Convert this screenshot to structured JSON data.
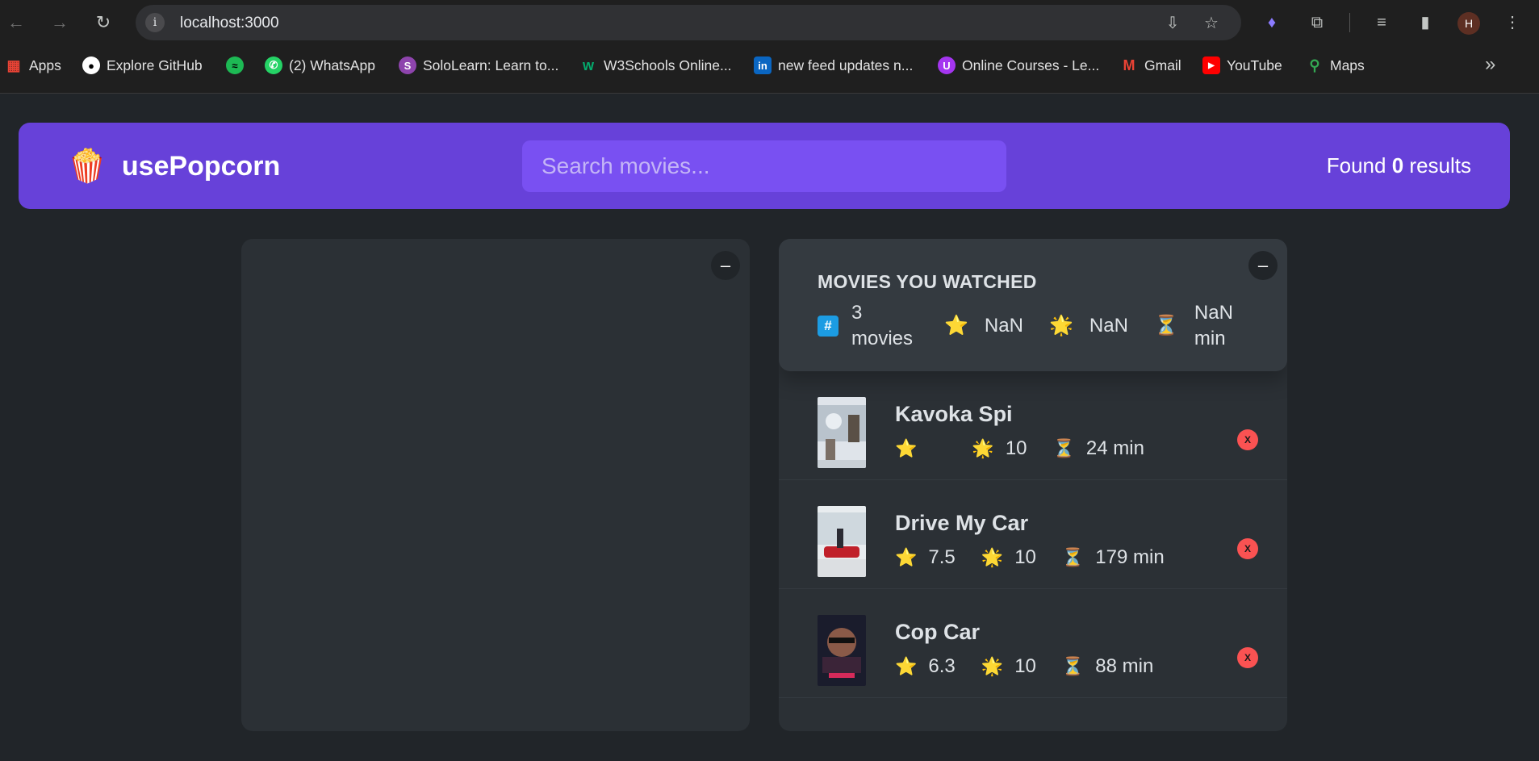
{
  "browser": {
    "url": "localhost:3000",
    "profile_initial": "H",
    "bookmarks": [
      {
        "label": "Apps",
        "icon": "apps-grid-icon",
        "color": "#ea4335"
      },
      {
        "label": "Explore GitHub",
        "icon": "github-icon",
        "color": "#ffffff"
      },
      {
        "label": "",
        "icon": "spotify-icon",
        "color": "#1db954"
      },
      {
        "label": "(2) WhatsApp",
        "icon": "whatsapp-icon",
        "color": "#25d366"
      },
      {
        "label": "SoloLearn: Learn to...",
        "icon": "sololearn-icon",
        "color": "#8e44ad"
      },
      {
        "label": "W3Schools Online...",
        "icon": "w3schools-icon",
        "color": "#04aa6d"
      },
      {
        "label": "new feed updates n...",
        "icon": "linkedin-icon",
        "color": "#0a66c2"
      },
      {
        "label": "Online Courses - Le...",
        "icon": "udemy-icon",
        "color": "#a435f0"
      },
      {
        "label": "Gmail",
        "icon": "gmail-icon",
        "color": "#ea4335"
      },
      {
        "label": "YouTube",
        "icon": "youtube-icon",
        "color": "#ff0000"
      },
      {
        "label": "Maps",
        "icon": "maps-icon",
        "color": "#34a853"
      }
    ]
  },
  "navbar": {
    "logo_icon": "🍿",
    "logo_text": "usePopcorn",
    "search_placeholder": "Search movies...",
    "results_prefix": "Found",
    "results_count": "0",
    "results_suffix": "results"
  },
  "left_box": {
    "toggle_label": "–"
  },
  "watched": {
    "toggle_label": "–",
    "title": "MOVIES YOU WATCHED",
    "stats": {
      "count_icon": "#",
      "count_number": "3",
      "count_label": "movies",
      "imdb_icon": "⭐️",
      "imdb_avg": "NaN",
      "user_icon": "🌟",
      "user_avg": "NaN",
      "runtime_icon": "⏳",
      "runtime_value": "NaN",
      "runtime_unit": "min"
    },
    "movies": [
      {
        "title": "Kavoka Spi",
        "imdb": "",
        "user": "10",
        "runtime": "24 min",
        "delete_label": "X"
      },
      {
        "title": "Drive My Car",
        "imdb": "7.5",
        "user": "10",
        "runtime": "179 min",
        "delete_label": "X"
      },
      {
        "title": "Cop Car",
        "imdb": "6.3",
        "user": "10",
        "runtime": "88 min",
        "delete_label": "X"
      }
    ]
  },
  "icons": {
    "star": "⭐️",
    "sparkle": "🌟",
    "hourglass": "⏳"
  },
  "colors": {
    "primary": "#6741d9",
    "primary_light": "#7950f2",
    "background": "#212529",
    "box": "#2b3035",
    "summary": "#343a40",
    "text": "#dee2e6",
    "delete": "#fa5252"
  }
}
